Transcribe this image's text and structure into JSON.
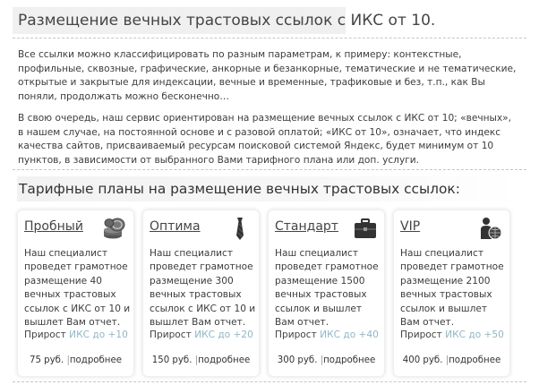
{
  "main_title": "Размещение вечных трастовых ссылок с ИКС от 10.",
  "paragraphs": [
    "Все ссылки можно классифицировать по разным параметрам, к примеру: контекстные, профильные, сквозные, графические, анкорные и безанкорные, тематические и не тематические, открытые и закрытые для индексации, вечные и временные, трафиковые и без, т.п., как Вы поняли, продолжать можно бесконечно…",
    "В свою очередь, наш сервис ориентирован на размещение вечных ссылок с ИКС от 10; «вечных», в нашем случае, на постоянной основе и с разовой оплатой; «ИКС от 10», означает, что индекс качества сайтов, присваиваемый ресурсам поисковой системой Яндекс, будет минимум от 10 пунктов, в зависимости от выбранного Вами тарифного плана или доп. услуги."
  ],
  "plans_title": "Тарифные планы на размещение вечных трастовых ссылок:",
  "plans": [
    {
      "name": "Пробный",
      "icon": "coins-icon",
      "desc_pre": "Наш специалист проведет грамотное размещение 40 вечных трастовых ссылок с ИКС от 10 и вышлет Вам отчет.",
      "growth_label": "Прирост",
      "growth_value": "ИКС до +10",
      "price": "75 руб.",
      "sep": "|",
      "more": "подробнее"
    },
    {
      "name": "Оптима",
      "icon": "tie-icon",
      "desc_pre": "Наш специалист проведет грамотное размещение 300 вечных трастовых ссылок с ИКС от 10 и вышлет Вам отчет.",
      "growth_label": "Прирост",
      "growth_value": "ИКС до +20",
      "price": "150 руб.",
      "sep": "|",
      "more": "подробнее"
    },
    {
      "name": "Стандарт",
      "icon": "briefcase-icon",
      "desc_pre": "Наш специалист проведет грамотное размещение 1500 вечных трастовых ссылок и вышлет Вам отчет.",
      "growth_label": "Прирост",
      "growth_value": "ИКС до +40",
      "price": "300 руб.",
      "sep": "|",
      "more": "подробнее"
    },
    {
      "name": "VIP",
      "icon": "globe-person-icon",
      "desc_pre": "Наш специалист проведет грамотное размещение 2100 вечных трастовых ссылок и вышлет Вам отчет.",
      "growth_label": "Прирост",
      "growth_value": "ИКС до +50",
      "price": "400 руб.",
      "sep": "|",
      "more": "подробнее"
    }
  ]
}
